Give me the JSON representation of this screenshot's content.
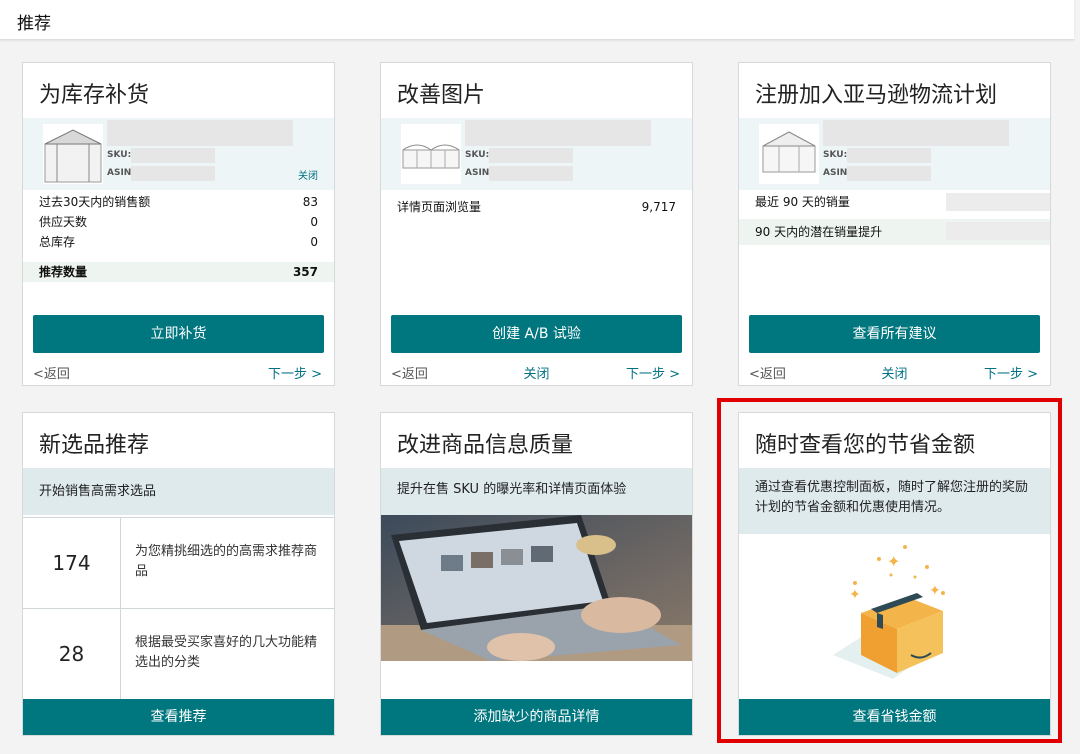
{
  "header": {
    "title": "推荐"
  },
  "cards": {
    "restock": {
      "title": "为库存补货",
      "sku_label": "SKU:",
      "asin_label": "ASIN:",
      "close": "关闭",
      "rows": [
        {
          "label": "过去30天内的销售额",
          "value": "83"
        },
        {
          "label": "供应天数",
          "value": "0"
        },
        {
          "label": "总库存",
          "value": "0"
        }
      ],
      "recommended": {
        "label": "推荐数量",
        "value": "357"
      },
      "button": "立即补货",
      "back": "<返回",
      "next": "下一步 >"
    },
    "images": {
      "title": "改善图片",
      "sku_label": "SKU:",
      "asin_label": "ASIN:",
      "row": {
        "label": "详情页面浏览量",
        "value": "9,717"
      },
      "button": "创建 A/B 试验",
      "back": "<返回",
      "close": "关闭",
      "next": "下一步 >"
    },
    "fba": {
      "title": "注册加入亚马逊物流计划",
      "sku_label": "SKU:",
      "asin_label": "ASIN:",
      "rows": [
        {
          "label": "最近 90 天的销量"
        },
        {
          "label": "90 天内的潜在销量提升"
        }
      ],
      "button": "查看所有建议",
      "back": "<返回",
      "close": "关闭",
      "next": "下一步 >"
    },
    "new_selection": {
      "title": "新选品推荐",
      "band": "开始销售高需求选品",
      "stats": [
        {
          "num": "174",
          "desc": "为您精挑细选的的高需求推荐商品"
        },
        {
          "num": "28",
          "desc": "根据最受买家喜好的几大功能精选出的分类"
        }
      ],
      "button": "查看推荐"
    },
    "listing_quality": {
      "title": "改进商品信息质量",
      "band": "提升在售 SKU 的曝光率和详情页面体验",
      "button": "添加缺少的商品详情"
    },
    "savings": {
      "title": "随时查看您的节省金额",
      "band": "通过查看优惠控制面板，随时了解您注册的奖励计划的节省金额和优惠使用情况。",
      "button": "查看省钱金额"
    }
  },
  "colors": {
    "accent": "#00767f",
    "highlight": "#e00000"
  }
}
